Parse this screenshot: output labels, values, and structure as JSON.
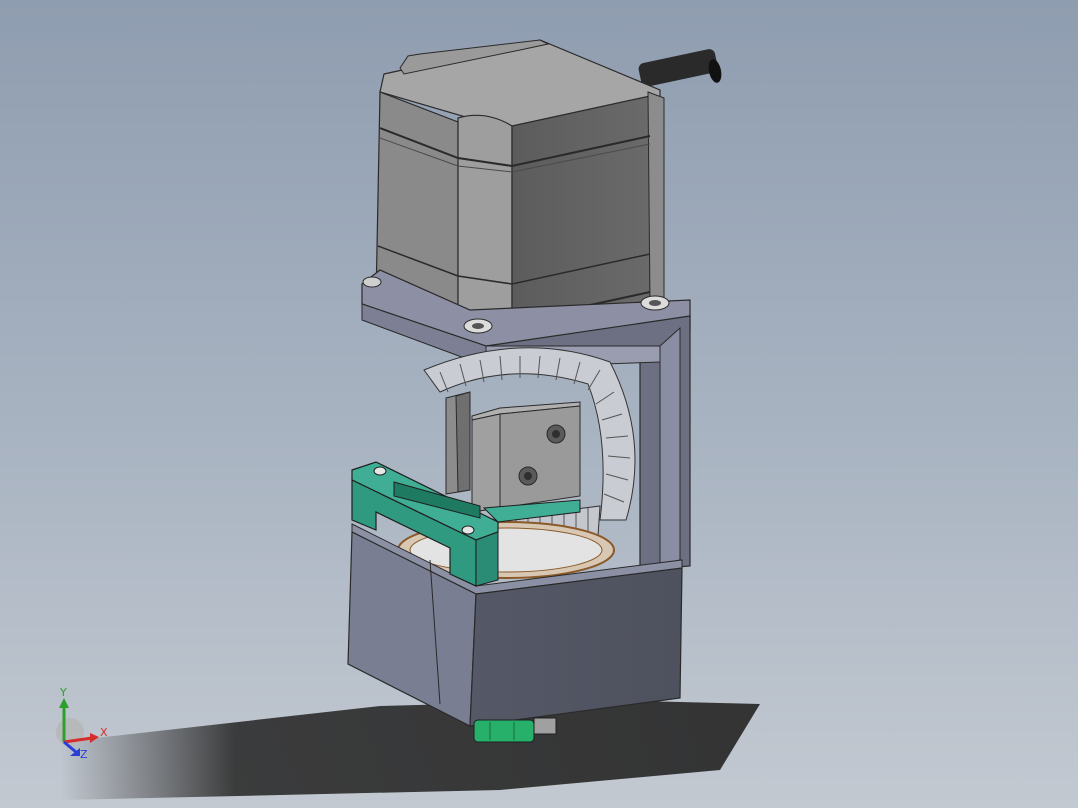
{
  "viewport": {
    "background_top": "#8f9db0",
    "background_bottom": "#c3c9d1"
  },
  "model": {
    "motor_color": "#6e6e6e",
    "gearbox_color": "#6a6e80",
    "bracket_color": "#3fae94",
    "gear_color": "#c9ccd2",
    "coupling_color": "#27b06a"
  },
  "triad": {
    "x_label": "X",
    "y_label": "Y",
    "z_label": "Z",
    "x_color": "#d62c2c",
    "y_color": "#2ca02c",
    "z_color": "#2b3fd6"
  }
}
